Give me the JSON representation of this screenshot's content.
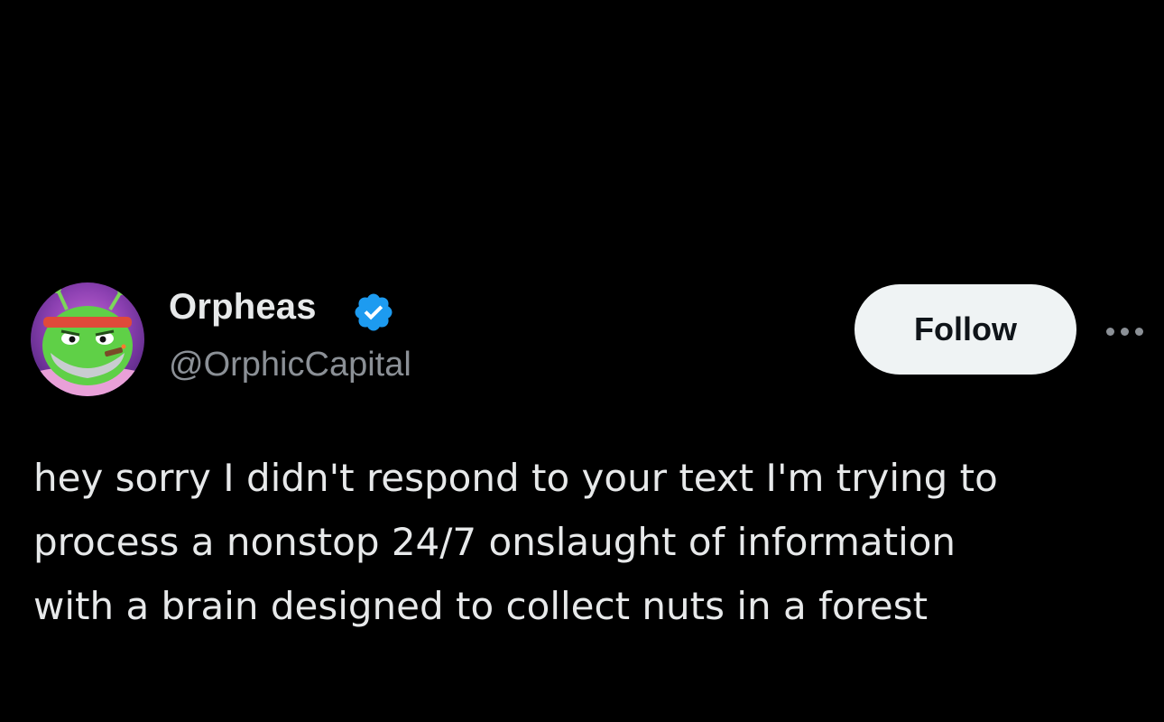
{
  "author": {
    "display_name": "Orpheas",
    "handle": "@OrphicCapital",
    "verified": true,
    "avatar_icon": "green-alien-cartoon-avatar"
  },
  "actions": {
    "follow_label": "Follow",
    "more_icon": "more-options-icon"
  },
  "tweet": {
    "lines": [
      "hey sorry I didn't respond to your text I'm trying to",
      "process a nonstop 24/7 onslaught of information",
      "with a brain designed to collect nuts in a forest"
    ]
  },
  "colors": {
    "background": "#000000",
    "primary_text": "#e7e9ea",
    "secondary_text": "#8b9096",
    "verified_blue": "#1d9bf0",
    "follow_button_bg": "#eff3f4"
  }
}
